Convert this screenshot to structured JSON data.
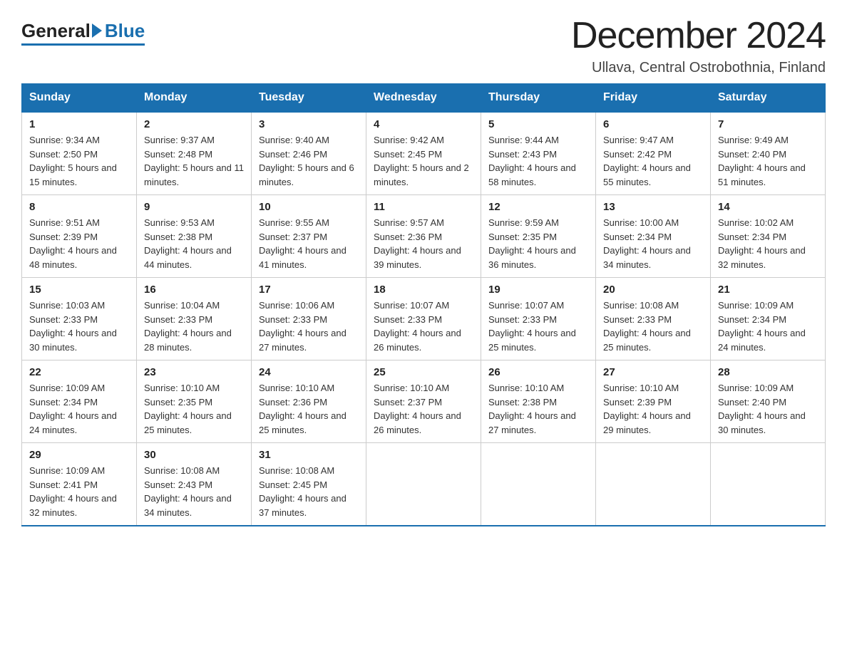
{
  "logo": {
    "general": "General",
    "blue": "Blue"
  },
  "title": "December 2024",
  "subtitle": "Ullava, Central Ostrobothnia, Finland",
  "weekdays": [
    "Sunday",
    "Monday",
    "Tuesday",
    "Wednesday",
    "Thursday",
    "Friday",
    "Saturday"
  ],
  "weeks": [
    [
      {
        "day": "1",
        "sunrise": "9:34 AM",
        "sunset": "2:50 PM",
        "daylight": "5 hours and 15 minutes."
      },
      {
        "day": "2",
        "sunrise": "9:37 AM",
        "sunset": "2:48 PM",
        "daylight": "5 hours and 11 minutes."
      },
      {
        "day": "3",
        "sunrise": "9:40 AM",
        "sunset": "2:46 PM",
        "daylight": "5 hours and 6 minutes."
      },
      {
        "day": "4",
        "sunrise": "9:42 AM",
        "sunset": "2:45 PM",
        "daylight": "5 hours and 2 minutes."
      },
      {
        "day": "5",
        "sunrise": "9:44 AM",
        "sunset": "2:43 PM",
        "daylight": "4 hours and 58 minutes."
      },
      {
        "day": "6",
        "sunrise": "9:47 AM",
        "sunset": "2:42 PM",
        "daylight": "4 hours and 55 minutes."
      },
      {
        "day": "7",
        "sunrise": "9:49 AM",
        "sunset": "2:40 PM",
        "daylight": "4 hours and 51 minutes."
      }
    ],
    [
      {
        "day": "8",
        "sunrise": "9:51 AM",
        "sunset": "2:39 PM",
        "daylight": "4 hours and 48 minutes."
      },
      {
        "day": "9",
        "sunrise": "9:53 AM",
        "sunset": "2:38 PM",
        "daylight": "4 hours and 44 minutes."
      },
      {
        "day": "10",
        "sunrise": "9:55 AM",
        "sunset": "2:37 PM",
        "daylight": "4 hours and 41 minutes."
      },
      {
        "day": "11",
        "sunrise": "9:57 AM",
        "sunset": "2:36 PM",
        "daylight": "4 hours and 39 minutes."
      },
      {
        "day": "12",
        "sunrise": "9:59 AM",
        "sunset": "2:35 PM",
        "daylight": "4 hours and 36 minutes."
      },
      {
        "day": "13",
        "sunrise": "10:00 AM",
        "sunset": "2:34 PM",
        "daylight": "4 hours and 34 minutes."
      },
      {
        "day": "14",
        "sunrise": "10:02 AM",
        "sunset": "2:34 PM",
        "daylight": "4 hours and 32 minutes."
      }
    ],
    [
      {
        "day": "15",
        "sunrise": "10:03 AM",
        "sunset": "2:33 PM",
        "daylight": "4 hours and 30 minutes."
      },
      {
        "day": "16",
        "sunrise": "10:04 AM",
        "sunset": "2:33 PM",
        "daylight": "4 hours and 28 minutes."
      },
      {
        "day": "17",
        "sunrise": "10:06 AM",
        "sunset": "2:33 PM",
        "daylight": "4 hours and 27 minutes."
      },
      {
        "day": "18",
        "sunrise": "10:07 AM",
        "sunset": "2:33 PM",
        "daylight": "4 hours and 26 minutes."
      },
      {
        "day": "19",
        "sunrise": "10:07 AM",
        "sunset": "2:33 PM",
        "daylight": "4 hours and 25 minutes."
      },
      {
        "day": "20",
        "sunrise": "10:08 AM",
        "sunset": "2:33 PM",
        "daylight": "4 hours and 25 minutes."
      },
      {
        "day": "21",
        "sunrise": "10:09 AM",
        "sunset": "2:34 PM",
        "daylight": "4 hours and 24 minutes."
      }
    ],
    [
      {
        "day": "22",
        "sunrise": "10:09 AM",
        "sunset": "2:34 PM",
        "daylight": "4 hours and 24 minutes."
      },
      {
        "day": "23",
        "sunrise": "10:10 AM",
        "sunset": "2:35 PM",
        "daylight": "4 hours and 25 minutes."
      },
      {
        "day": "24",
        "sunrise": "10:10 AM",
        "sunset": "2:36 PM",
        "daylight": "4 hours and 25 minutes."
      },
      {
        "day": "25",
        "sunrise": "10:10 AM",
        "sunset": "2:37 PM",
        "daylight": "4 hours and 26 minutes."
      },
      {
        "day": "26",
        "sunrise": "10:10 AM",
        "sunset": "2:38 PM",
        "daylight": "4 hours and 27 minutes."
      },
      {
        "day": "27",
        "sunrise": "10:10 AM",
        "sunset": "2:39 PM",
        "daylight": "4 hours and 29 minutes."
      },
      {
        "day": "28",
        "sunrise": "10:09 AM",
        "sunset": "2:40 PM",
        "daylight": "4 hours and 30 minutes."
      }
    ],
    [
      {
        "day": "29",
        "sunrise": "10:09 AM",
        "sunset": "2:41 PM",
        "daylight": "4 hours and 32 minutes."
      },
      {
        "day": "30",
        "sunrise": "10:08 AM",
        "sunset": "2:43 PM",
        "daylight": "4 hours and 34 minutes."
      },
      {
        "day": "31",
        "sunrise": "10:08 AM",
        "sunset": "2:45 PM",
        "daylight": "4 hours and 37 minutes."
      },
      null,
      null,
      null,
      null
    ]
  ],
  "labels": {
    "sunrise": "Sunrise:",
    "sunset": "Sunset:",
    "daylight": "Daylight:"
  }
}
